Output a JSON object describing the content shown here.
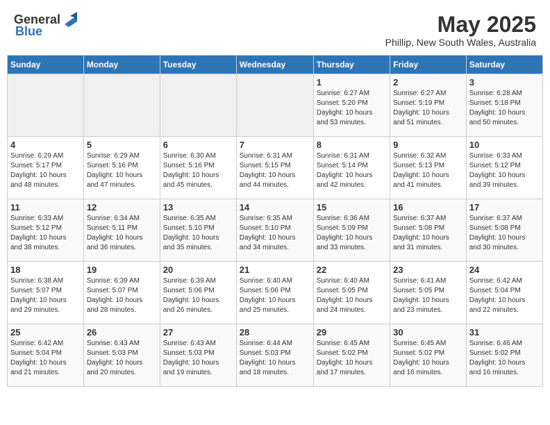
{
  "header": {
    "logo_general": "General",
    "logo_blue": "Blue",
    "title": "May 2025",
    "subtitle": "Phillip, New South Wales, Australia"
  },
  "weekdays": [
    "Sunday",
    "Monday",
    "Tuesday",
    "Wednesday",
    "Thursday",
    "Friday",
    "Saturday"
  ],
  "weeks": [
    [
      {
        "day": "",
        "info": ""
      },
      {
        "day": "",
        "info": ""
      },
      {
        "day": "",
        "info": ""
      },
      {
        "day": "",
        "info": ""
      },
      {
        "day": "1",
        "info": "Sunrise: 6:27 AM\nSunset: 5:20 PM\nDaylight: 10 hours\nand 53 minutes."
      },
      {
        "day": "2",
        "info": "Sunrise: 6:27 AM\nSunset: 5:19 PM\nDaylight: 10 hours\nand 51 minutes."
      },
      {
        "day": "3",
        "info": "Sunrise: 6:28 AM\nSunset: 5:18 PM\nDaylight: 10 hours\nand 50 minutes."
      }
    ],
    [
      {
        "day": "4",
        "info": "Sunrise: 6:29 AM\nSunset: 5:17 PM\nDaylight: 10 hours\nand 48 minutes."
      },
      {
        "day": "5",
        "info": "Sunrise: 6:29 AM\nSunset: 5:16 PM\nDaylight: 10 hours\nand 47 minutes."
      },
      {
        "day": "6",
        "info": "Sunrise: 6:30 AM\nSunset: 5:16 PM\nDaylight: 10 hours\nand 45 minutes."
      },
      {
        "day": "7",
        "info": "Sunrise: 6:31 AM\nSunset: 5:15 PM\nDaylight: 10 hours\nand 44 minutes."
      },
      {
        "day": "8",
        "info": "Sunrise: 6:31 AM\nSunset: 5:14 PM\nDaylight: 10 hours\nand 42 minutes."
      },
      {
        "day": "9",
        "info": "Sunrise: 6:32 AM\nSunset: 5:13 PM\nDaylight: 10 hours\nand 41 minutes."
      },
      {
        "day": "10",
        "info": "Sunrise: 6:33 AM\nSunset: 5:12 PM\nDaylight: 10 hours\nand 39 minutes."
      }
    ],
    [
      {
        "day": "11",
        "info": "Sunrise: 6:33 AM\nSunset: 5:12 PM\nDaylight: 10 hours\nand 38 minutes."
      },
      {
        "day": "12",
        "info": "Sunrise: 6:34 AM\nSunset: 5:11 PM\nDaylight: 10 hours\nand 36 minutes."
      },
      {
        "day": "13",
        "info": "Sunrise: 6:35 AM\nSunset: 5:10 PM\nDaylight: 10 hours\nand 35 minutes."
      },
      {
        "day": "14",
        "info": "Sunrise: 6:35 AM\nSunset: 5:10 PM\nDaylight: 10 hours\nand 34 minutes."
      },
      {
        "day": "15",
        "info": "Sunrise: 6:36 AM\nSunset: 5:09 PM\nDaylight: 10 hours\nand 33 minutes."
      },
      {
        "day": "16",
        "info": "Sunrise: 6:37 AM\nSunset: 5:08 PM\nDaylight: 10 hours\nand 31 minutes."
      },
      {
        "day": "17",
        "info": "Sunrise: 6:37 AM\nSunset: 5:08 PM\nDaylight: 10 hours\nand 30 minutes."
      }
    ],
    [
      {
        "day": "18",
        "info": "Sunrise: 6:38 AM\nSunset: 5:07 PM\nDaylight: 10 hours\nand 29 minutes."
      },
      {
        "day": "19",
        "info": "Sunrise: 6:39 AM\nSunset: 5:07 PM\nDaylight: 10 hours\nand 28 minutes."
      },
      {
        "day": "20",
        "info": "Sunrise: 6:39 AM\nSunset: 5:06 PM\nDaylight: 10 hours\nand 26 minutes."
      },
      {
        "day": "21",
        "info": "Sunrise: 6:40 AM\nSunset: 5:06 PM\nDaylight: 10 hours\nand 25 minutes."
      },
      {
        "day": "22",
        "info": "Sunrise: 6:40 AM\nSunset: 5:05 PM\nDaylight: 10 hours\nand 24 minutes."
      },
      {
        "day": "23",
        "info": "Sunrise: 6:41 AM\nSunset: 5:05 PM\nDaylight: 10 hours\nand 23 minutes."
      },
      {
        "day": "24",
        "info": "Sunrise: 6:42 AM\nSunset: 5:04 PM\nDaylight: 10 hours\nand 22 minutes."
      }
    ],
    [
      {
        "day": "25",
        "info": "Sunrise: 6:42 AM\nSunset: 5:04 PM\nDaylight: 10 hours\nand 21 minutes."
      },
      {
        "day": "26",
        "info": "Sunrise: 6:43 AM\nSunset: 5:03 PM\nDaylight: 10 hours\nand 20 minutes."
      },
      {
        "day": "27",
        "info": "Sunrise: 6:43 AM\nSunset: 5:03 PM\nDaylight: 10 hours\nand 19 minutes."
      },
      {
        "day": "28",
        "info": "Sunrise: 6:44 AM\nSunset: 5:03 PM\nDaylight: 10 hours\nand 18 minutes."
      },
      {
        "day": "29",
        "info": "Sunrise: 6:45 AM\nSunset: 5:02 PM\nDaylight: 10 hours\nand 17 minutes."
      },
      {
        "day": "30",
        "info": "Sunrise: 6:45 AM\nSunset: 5:02 PM\nDaylight: 10 hours\nand 16 minutes."
      },
      {
        "day": "31",
        "info": "Sunrise: 6:46 AM\nSunset: 5:02 PM\nDaylight: 10 hours\nand 16 minutes."
      }
    ]
  ]
}
